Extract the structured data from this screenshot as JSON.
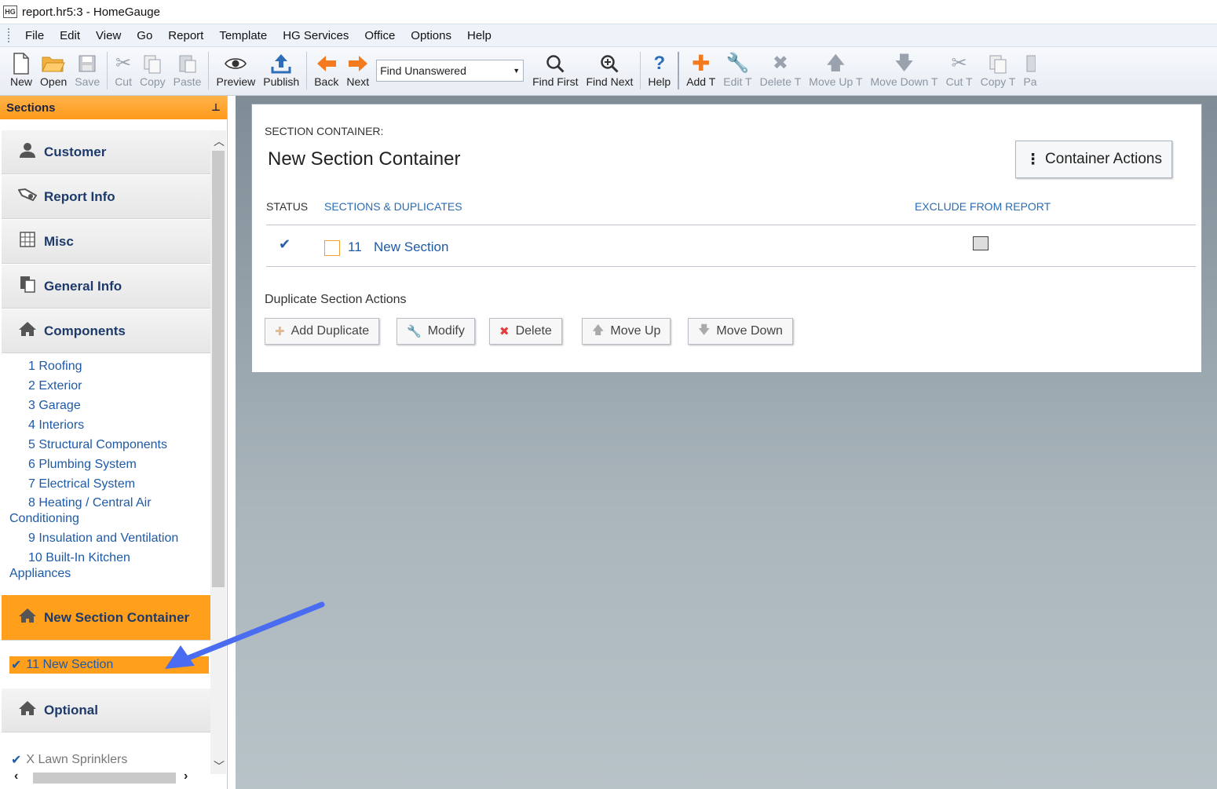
{
  "window": {
    "title": "report.hr5:3 - HomeGauge",
    "app_icon_text": "HG"
  },
  "menu": [
    "File",
    "Edit",
    "View",
    "Go",
    "Report",
    "Template",
    "HG Services",
    "Office",
    "Options",
    "Help"
  ],
  "toolbar": {
    "new": "New",
    "open": "Open",
    "save": "Save",
    "cut": "Cut",
    "copy": "Copy",
    "paste": "Paste",
    "preview": "Preview",
    "publish": "Publish",
    "back": "Back",
    "next": "Next",
    "find_select": "Find Unanswered",
    "find_first": "Find First",
    "find_next": "Find Next",
    "help": "Help",
    "add_t": "Add T",
    "edit_t": "Edit T",
    "delete_t": "Delete T",
    "move_up_t": "Move Up T",
    "move_down_t": "Move Down T",
    "cut_t": "Cut T",
    "copy_t": "Copy T",
    "pa": "Pa"
  },
  "sidebar": {
    "header": "Sections",
    "pin": "⊥",
    "groups": {
      "customer": "Customer",
      "report_info": "Report Info",
      "misc": "Misc",
      "general_info": "General Info",
      "components": "Components",
      "new_section_container": "New Section Container",
      "optional": "Optional"
    },
    "components": [
      {
        "num": "1",
        "name": "Roofing"
      },
      {
        "num": "2",
        "name": "Exterior"
      },
      {
        "num": "3",
        "name": "Garage"
      },
      {
        "num": "4",
        "name": "Interiors"
      },
      {
        "num": "5",
        "name": "Structural Components"
      },
      {
        "num": "6",
        "name": "Plumbing System"
      },
      {
        "num": "7",
        "name": "Electrical System"
      },
      {
        "num": "8",
        "name": "Heating / Central Air",
        "cont": "Conditioning"
      },
      {
        "num": "9",
        "name": "Insulation and Ventilation"
      },
      {
        "num": "10",
        "name": "Built-In Kitchen",
        "cont": "Appliances"
      }
    ],
    "selected_item": "11 New Section",
    "optional_item": "X Lawn Sprinklers"
  },
  "main": {
    "section_label": "SECTION CONTAINER:",
    "title": "New Section Container",
    "container_actions": "Container Actions",
    "col_status": "STATUS",
    "col_sections": "SECTIONS & DUPLICATES",
    "col_exclude": "EXCLUDE FROM REPORT",
    "row": {
      "num": "11",
      "name": "New Section"
    },
    "dup_label": "Duplicate Section Actions",
    "actions": {
      "add": "Add Duplicate",
      "modify": "Modify",
      "delete": "Delete",
      "move_up": "Move Up",
      "move_down": "Move Down"
    }
  },
  "colors": {
    "accent_orange": "#ff9f1c",
    "link_blue": "#1e5aa6",
    "annotation_arrow": "#4a6cf0"
  }
}
